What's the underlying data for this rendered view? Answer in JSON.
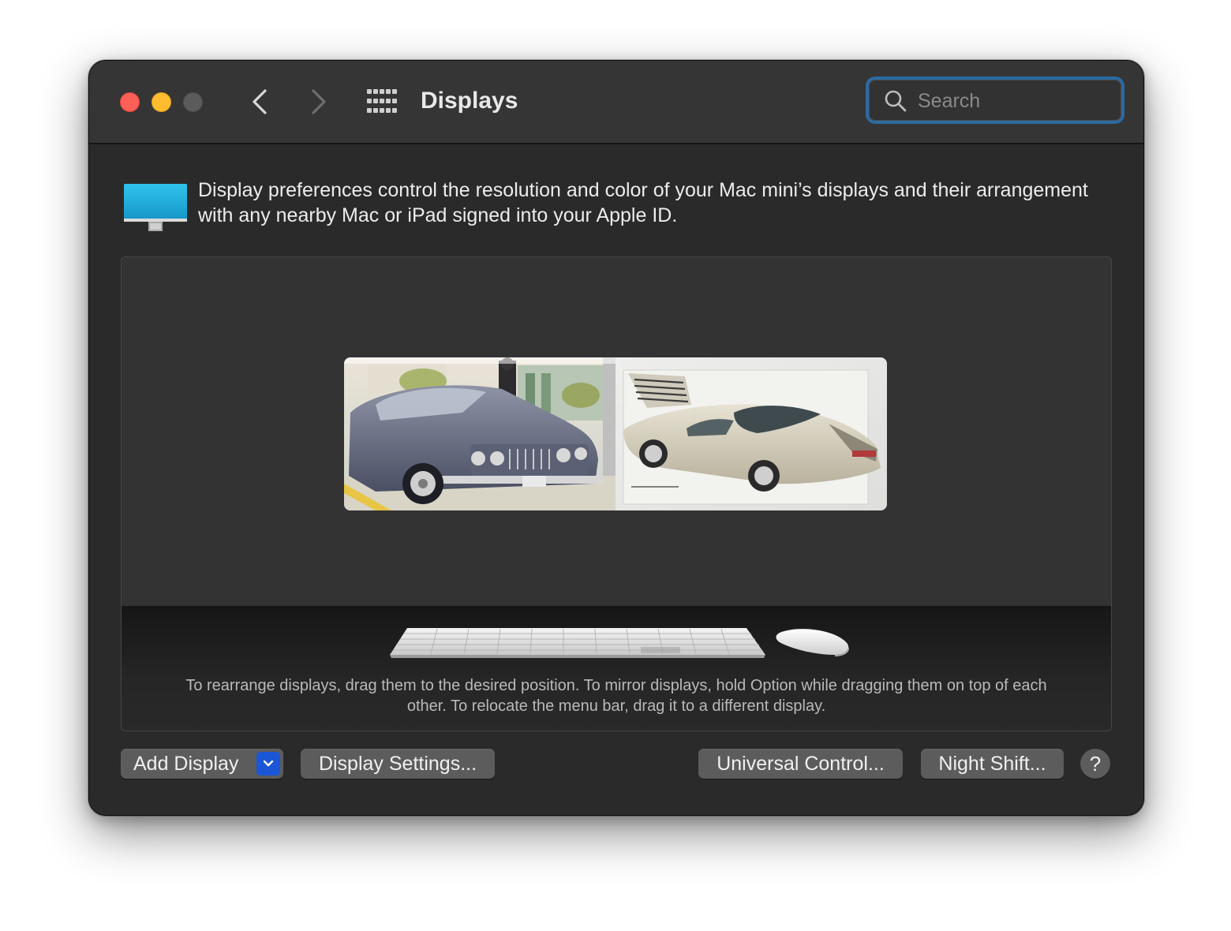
{
  "window": {
    "title": "Displays"
  },
  "search": {
    "placeholder": "Search",
    "value": ""
  },
  "header": {
    "description": "Display preferences control the resolution and color of your Mac mini’s displays and their arrangement with any nearby Mac or iPad signed into your Apple ID."
  },
  "arrangement": {
    "displays": [
      {
        "name": "display-1",
        "wallpaper": "vintage dark car illustration",
        "has_menu_bar": true
      },
      {
        "name": "display-2",
        "wallpaper": "silver concept car sketch",
        "has_menu_bar": false
      }
    ],
    "hint": "To rearrange displays, drag them to the desired position. To mirror displays, hold Option while dragging them on top of each other. To relocate the menu bar, drag it to a different display."
  },
  "buttons": {
    "add_display": "Add Display",
    "display_settings": "Display Settings...",
    "universal_control": "Universal Control...",
    "night_shift": "Night Shift...",
    "help": "?"
  },
  "colors": {
    "window_bg": "#2a2a2a",
    "titlebar_bg": "#353535",
    "close": "#fe5f57",
    "minimize": "#febc2e",
    "zoom_disabled": "#5b5b5b",
    "search_focus": "#2b6aa1",
    "accent_dropdown": "#1b56d6",
    "button_bg": "#5c5c5c"
  },
  "icons": [
    "back-chevron-icon",
    "forward-chevron-icon",
    "show-all-grid-icon",
    "search-icon",
    "display-monitor-icon",
    "keyboard-icon",
    "mouse-icon",
    "chevron-down-icon"
  ]
}
